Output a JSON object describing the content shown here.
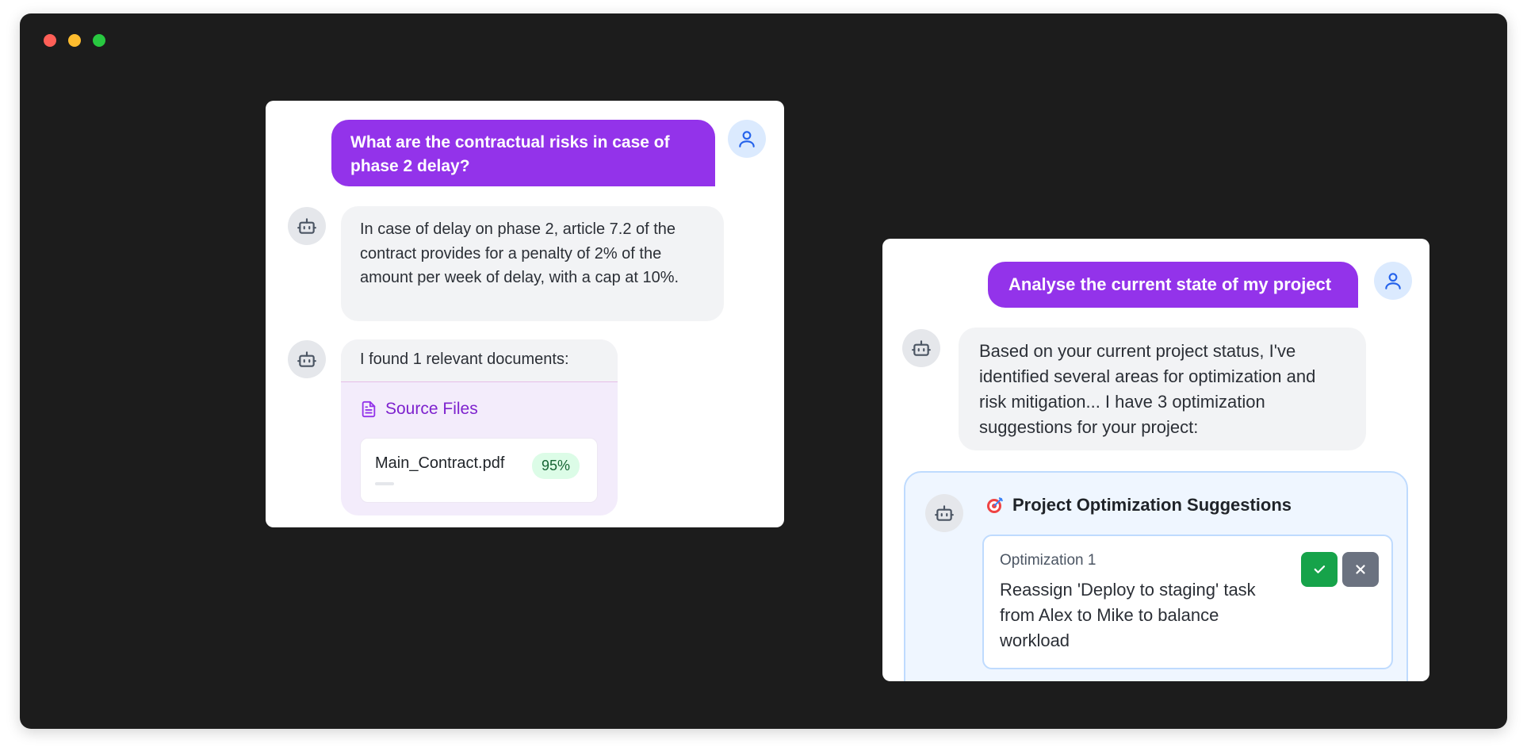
{
  "window": {
    "controls": [
      "close",
      "minimize",
      "maximize"
    ]
  },
  "left_chat": {
    "user_message": "What are the contractual risks in case of phase 2 delay?",
    "bot_answer": "In case of delay on phase 2, article 7.2 of the contract provides for a penalty of 2% of the amount per week of delay, with a cap at 10%.",
    "documents_intro": "I found 1 relevant documents:",
    "sources_title": "Source Files",
    "files": [
      {
        "name": "Main_Contract.pdf",
        "relevance": "95%"
      }
    ]
  },
  "right_chat": {
    "user_message": "Analyse the current state of my project",
    "bot_answer": "Based on your current project status, I've identified several areas for optimization and risk mitigation... I have 3 optimization suggestions for your project:",
    "suggestions_title": "Project Optimization Suggestions",
    "suggestions": [
      {
        "label": "Optimization 1",
        "text": "Reassign 'Deploy to staging' task from Alex to Mike to balance workload"
      }
    ]
  },
  "colors": {
    "user_bubble": "#9333ea",
    "bot_bubble": "#f2f3f5",
    "accept": "#16a34a",
    "reject": "#6b7280",
    "suggestion_bg": "#eff6ff"
  },
  "icons": [
    "user-icon",
    "bot-icon",
    "document-icon",
    "target-icon",
    "check-icon",
    "close-icon"
  ]
}
